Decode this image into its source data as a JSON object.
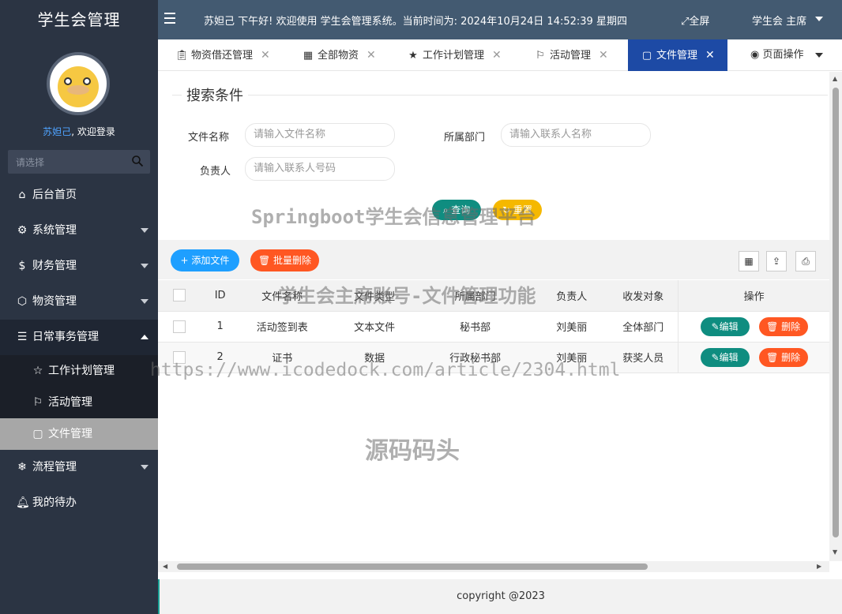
{
  "app": {
    "title": "学生会管理"
  },
  "user": {
    "name": "苏妲己",
    "welcome_suffix": ", 欢迎登录"
  },
  "sidebar": {
    "search_placeholder": "请选择",
    "menu": [
      {
        "label": "后台首页",
        "icon": "home-icon"
      },
      {
        "label": "系统管理",
        "icon": "gear-icon"
      },
      {
        "label": "财务管理",
        "icon": "dollar-icon"
      },
      {
        "label": "物资管理",
        "icon": "cube-icon"
      },
      {
        "label": "日常事务管理",
        "icon": "sliders-icon"
      },
      {
        "label": "流程管理",
        "icon": "snowflake-icon"
      },
      {
        "label": "我的待办",
        "icon": "bell-icon"
      }
    ],
    "submenu": [
      {
        "label": "工作计划管理",
        "icon": "star-icon"
      },
      {
        "label": "活动管理",
        "icon": "flag-icon"
      },
      {
        "label": "文件管理",
        "icon": "file-icon"
      }
    ]
  },
  "header": {
    "greeting": "苏妲己 下午好!  欢迎使用 学生会管理系统。当前时间为:  2024年10月24日 14:52:39   星期四",
    "fullscreen_label": "全屏",
    "role_label": "学生会 主席"
  },
  "tabs": [
    {
      "label": "物资借还管理",
      "icon": "clipboard-icon"
    },
    {
      "label": "全部物资",
      "icon": "grid-icon"
    },
    {
      "label": "工作计划管理",
      "icon": "star-icon"
    },
    {
      "label": "活动管理",
      "icon": "flag-icon"
    },
    {
      "label": "文件管理",
      "icon": "file-icon",
      "active": true
    }
  ],
  "page_ops_label": "页面操作",
  "search": {
    "title": "搜索条件",
    "fields": [
      {
        "label": "文件名称",
        "placeholder": "请输入文件名称"
      },
      {
        "label": "所属部门",
        "placeholder": "请输入联系人名称"
      },
      {
        "label": "负责人",
        "placeholder": "请输入联系人号码"
      }
    ],
    "query_label": "查询",
    "reset_label": "重置"
  },
  "toolbar": {
    "add_label": "添加文件",
    "batch_delete_label": "批量删除"
  },
  "table": {
    "columns": [
      "ID",
      "文件名称",
      "文件类型",
      "所属部门",
      "负责人",
      "收发对象",
      "操作"
    ],
    "rows": [
      {
        "id": "1",
        "name": "活动签到表",
        "type": "文本文件",
        "dept": "秘书部",
        "owner": "刘美丽",
        "target": "全体部门"
      },
      {
        "id": "2",
        "name": "证书",
        "type": "数据",
        "dept": "行政秘书部",
        "owner": "刘美丽",
        "target": "获奖人员"
      }
    ],
    "edit_label": "编辑",
    "delete_label": "删除"
  },
  "footer": {
    "copyright": "copyright @2023"
  },
  "watermarks": {
    "platform": "Springboot学生会信息管理平台",
    "feature": "学生会主席账号-文件管理功能",
    "url": "https://www.icodedock.com/article/2304.html",
    "site": "源码码头"
  }
}
